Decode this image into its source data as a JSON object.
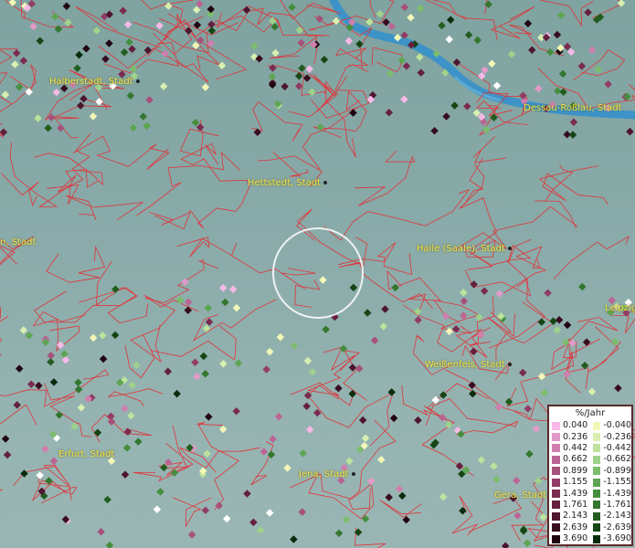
{
  "map": {
    "city_labels": [
      {
        "id": "halberstadt",
        "text": "Halberstadt, Stadt"
      },
      {
        "id": "dessau",
        "text": "Dessau-Roßlau, Stadt"
      },
      {
        "id": "hettstedt",
        "text": "Hettstedt, Stadt"
      },
      {
        "id": "left-edge",
        "text": "n, Stadt"
      },
      {
        "id": "halle",
        "text": "Halle (Saale), Stadt"
      },
      {
        "id": "leipzig",
        "text": "Leipzig"
      },
      {
        "id": "weissenfels",
        "text": "Weißenfels, Stadt"
      },
      {
        "id": "erfurt",
        "text": "Erfurt, Stadt"
      },
      {
        "id": "jena",
        "text": "Jena, Stadt"
      },
      {
        "id": "gera",
        "text": "Gera, Stadt"
      }
    ],
    "colors": {
      "boundary": "#e0343a",
      "river": "#3d93c7",
      "label": "#f0e34a"
    }
  },
  "legend": {
    "title": "%/Jahr",
    "rows": [
      {
        "pos": "0.040",
        "pos_color": "#f7b9e6",
        "neg": "-0.040",
        "neg_color": "#f2f7b8"
      },
      {
        "pos": "0.236",
        "pos_color": "#e29ac8",
        "neg": "-0.236",
        "neg_color": "#d9efb0"
      },
      {
        "pos": "0.442",
        "pos_color": "#cf7fae",
        "neg": "-0.442",
        "neg_color": "#bde39c"
      },
      {
        "pos": "0.662",
        "pos_color": "#bb6594",
        "neg": "-0.662",
        "neg_color": "#9fd28a"
      },
      {
        "pos": "0.899",
        "pos_color": "#a6507b",
        "neg": "-0.899",
        "neg_color": "#7cbd6d"
      },
      {
        "pos": "1.155",
        "pos_color": "#913d65",
        "neg": "-1.155",
        "neg_color": "#5ea552"
      },
      {
        "pos": "1.439",
        "pos_color": "#7a2c50",
        "neg": "-1.439",
        "neg_color": "#468e3e"
      },
      {
        "pos": "1.761",
        "pos_color": "#64203e",
        "neg": "-1.761",
        "neg_color": "#33772e"
      },
      {
        "pos": "2.143",
        "pos_color": "#4e152e",
        "neg": "-2.143",
        "neg_color": "#225d1f"
      },
      {
        "pos": "2.639",
        "pos_color": "#380c1f",
        "neg": "-2.639",
        "neg_color": "#164516"
      },
      {
        "pos": "3.690",
        "pos_color": "#200510",
        "neg": "-3.690",
        "neg_color": "#0a2b0c"
      }
    ]
  }
}
